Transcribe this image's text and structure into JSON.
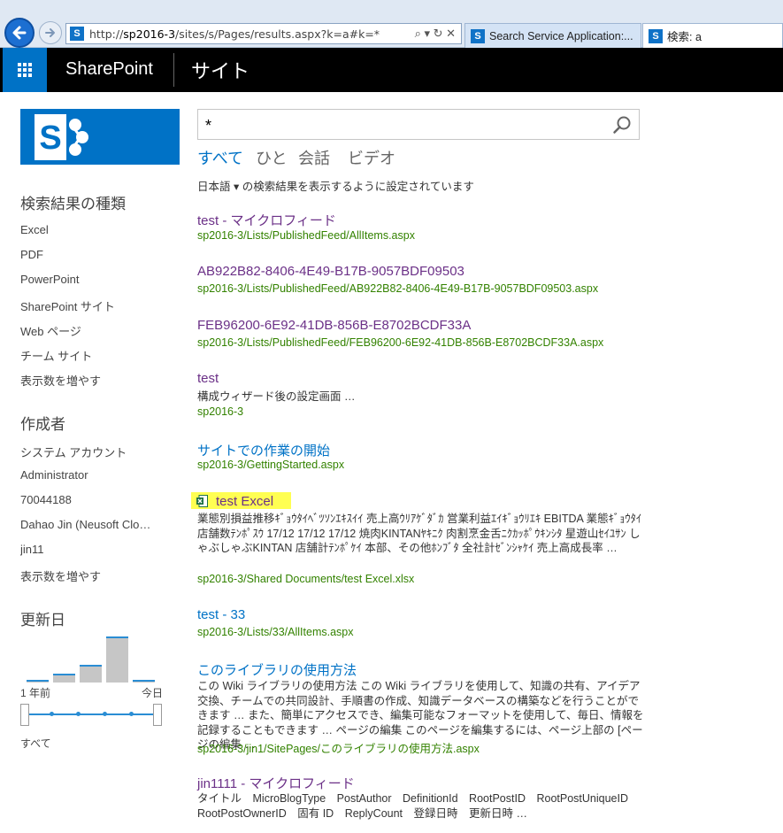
{
  "browser": {
    "address_prefix": "http://",
    "address_host": "sp2016-3",
    "address_path": "/sites/s/Pages/results.aspx?k=a#k=*",
    "address_tools": "⌕ ▾ ↻ ✕",
    "tabs": [
      {
        "label": "Search Service Application:..."
      },
      {
        "label": "検索: a"
      }
    ]
  },
  "suite_bar": {
    "brand": "SharePoint",
    "site_link": "サイト"
  },
  "search": {
    "query": "*",
    "verticals": [
      "すべて",
      "ひと",
      "会話",
      "ビデオ"
    ],
    "language_note": "日本語 ▾ の検索結果を表示するように設定されています"
  },
  "refiners": {
    "result_type": {
      "heading": "検索結果の種類",
      "items": [
        "Excel",
        "PDF",
        "PowerPoint",
        "SharePoint サイト",
        "Web ページ",
        "チーム サイト"
      ],
      "show_more": "表示数を増やす"
    },
    "author": {
      "heading": "作成者",
      "items": [
        "システム アカウント",
        "Administrator",
        "70044188",
        "Dahao Jin (Neusoft Clo…",
        "jin11"
      ],
      "show_more": "表示数を増やす"
    },
    "modified": {
      "heading": "更新日",
      "histogram": [
        0.05,
        0.2,
        0.38,
        1.0,
        0.05
      ],
      "label_start": "1 年前",
      "label_end": "今日",
      "all_label": "すべて"
    }
  },
  "results": [
    {
      "title": "test - マイクロフィード",
      "url": "sp2016-3/Lists/PublishedFeed/AllItems.aspx",
      "style": "visited"
    },
    {
      "title": "AB922B82-8406-4E49-B17B-9057BDF09503",
      "url": "sp2016-3/Lists/PublishedFeed/AB922B82-8406-4E49-B17B-9057BDF09503.aspx",
      "style": "visited"
    },
    {
      "title": "FEB96200-6E92-41DB-856B-E8702BCDF33A",
      "url": "sp2016-3/Lists/PublishedFeed/FEB96200-6E92-41DB-856B-E8702BCDF33A.aspx",
      "style": "visited"
    },
    {
      "title": "test",
      "summary": "構成ウィザード後の設定画面 …",
      "url": "sp2016-3",
      "style": "visited"
    },
    {
      "title": "サイトでの作業の開始",
      "url": "sp2016-3/GettingStarted.aspx",
      "style": "link"
    },
    {
      "title": "test Excel",
      "summary": "業態別損益推移ｷﾞｮｳﾀｲﾍﾞﾂｿﾝｴｷｽｲｲ 売上高ｳﾘｱｹﾞﾀﾞｶ 営業利益ｴｲｷﾞｮｳﾘｴｷ EBITDA 業態ｷﾞｮｳﾀｲ 店舗数ﾃﾝﾎﾟｽｳ 17/12 17/12 17/12 焼肉KINTANﾔｷﾆｸ 肉割烹金舌ﾆｸｶｯﾎﾟｳｷﾝｼﾀ 星遊山ｾｲﾕｻﾝ しゃぶしゃぶKINTAN 店舗計ﾃﾝﾎﾟｹｲ 本部、その他ﾎﾝﾌﾞﾀ 全社計ｾﾞﾝｼｬｹｲ 売上高成長率 …",
      "url": "sp2016-3/Shared Documents/test Excel.xlsx",
      "style": "visited"
    },
    {
      "title": "test - 33",
      "url": "sp2016-3/Lists/33/AllItems.aspx",
      "style": "link"
    },
    {
      "title": "このライブラリの使用方法",
      "summary": "この Wiki ライブラリの使用方法 この Wiki ライブラリを使用して、知識の共有、アイデア交換、チームでの共同設計、手順書の作成、知識データベースの構築などを行うことができます … また、簡単にアクセスでき、編集可能なフォーマットを使用して、毎日、情報を記録することもできます … ページの編集 このページを編集するには、ページ上部の [ページの編集 …",
      "url": "sp2016-3/jin1/SitePages/このライブラリの使用方法.aspx",
      "style": "link"
    },
    {
      "title": "jin1111 - マイクロフィード",
      "summary": "タイトル　MicroBlogType　PostAuthor　DefinitionId　RootPostID　RootPostUniqueID　RootPostOwnerID　固有 ID　ReplyCount　登録日時　更新日時 …",
      "style": "visited"
    }
  ],
  "colors": {
    "brand_blue": "#0072c6",
    "visited_purple": "#6b3087",
    "url_green": "#338200",
    "highlight_yellow": "#ffff52"
  }
}
